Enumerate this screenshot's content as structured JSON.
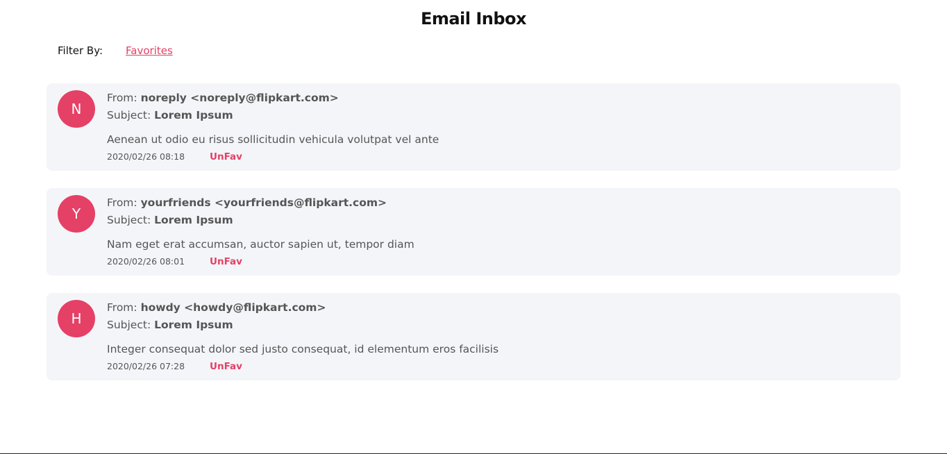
{
  "header": {
    "title": "Email Inbox"
  },
  "filter": {
    "label": "Filter By:",
    "options": [
      "Favorites"
    ]
  },
  "emails": [
    {
      "avatar_letter": "N",
      "from_label": "From: ",
      "from_value": "noreply <noreply@flipkart.com>",
      "subject_label": "Subject: ",
      "subject_value": "Lorem Ipsum",
      "snippet": "Aenean ut odio eu risus sollicitudin vehicula volutpat vel ante",
      "date": "2020/02/26 08:18",
      "fav_action": "UnFav"
    },
    {
      "avatar_letter": "Y",
      "from_label": "From: ",
      "from_value": "yourfriends <yourfriends@flipkart.com>",
      "subject_label": "Subject: ",
      "subject_value": "Lorem Ipsum",
      "snippet": "Nam eget erat accumsan, auctor sapien ut, tempor diam",
      "date": "2020/02/26 08:01",
      "fav_action": "UnFav"
    },
    {
      "avatar_letter": "H",
      "from_label": "From: ",
      "from_value": "howdy <howdy@flipkart.com>",
      "subject_label": "Subject: ",
      "subject_value": "Lorem Ipsum",
      "snippet": "Integer consequat dolor sed justo consequat, id elementum eros facilisis",
      "date": "2020/02/26 07:28",
      "fav_action": "UnFav"
    }
  ],
  "colors": {
    "accent": "#e54065",
    "card_background": "#f4f5f9",
    "text": "#555555",
    "title": "#111111"
  }
}
